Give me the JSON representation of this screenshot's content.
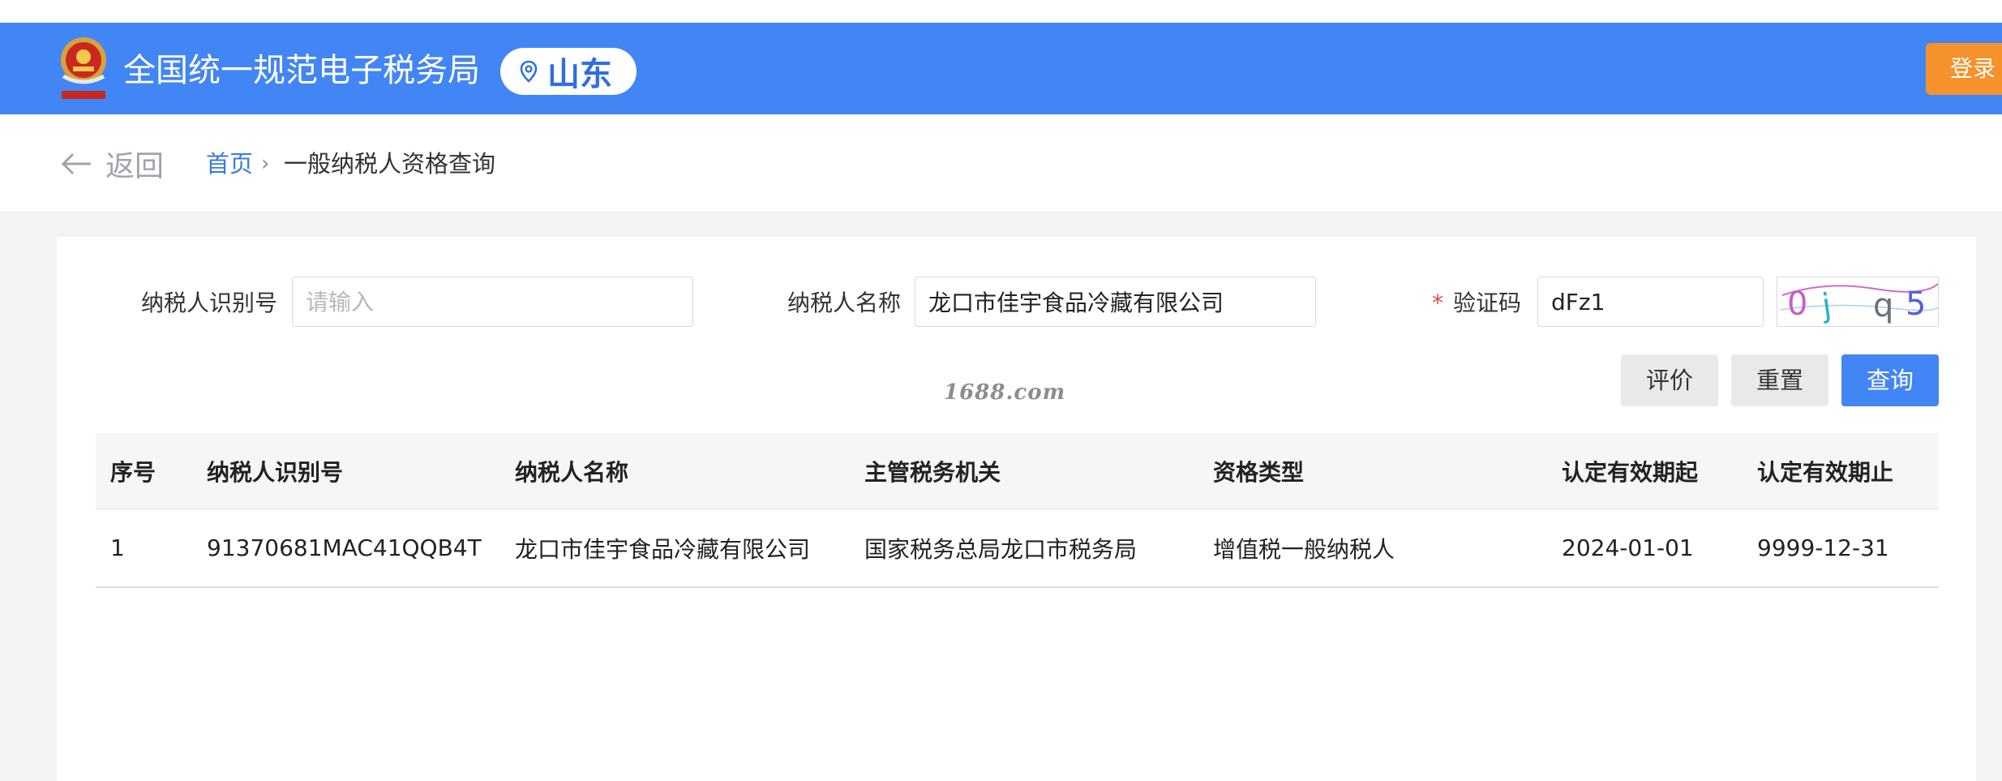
{
  "header": {
    "site_title": "全国统一规范电子税务局",
    "region": "山东",
    "login_label": "登录",
    "brand_color": "#4285f4",
    "login_color": "#f5922b"
  },
  "nav": {
    "back_label": "返回",
    "breadcrumb_home": "首页",
    "breadcrumb_separator": "›",
    "breadcrumb_current": "一般纳税人资格查询"
  },
  "form": {
    "taxpayer_id_label": "纳税人识别号",
    "taxpayer_id_value": "",
    "taxpayer_id_placeholder": "请输入",
    "taxpayer_name_label": "纳税人名称",
    "taxpayer_name_value": "龙口市佳宇食品冷藏有限公司",
    "captcha_required_mark": "*",
    "captcha_label": "验证码",
    "captcha_value": "dFz1",
    "captcha_image_text": "0j q5"
  },
  "buttons": {
    "rate_label": "评价",
    "reset_label": "重置",
    "query_label": "查询"
  },
  "watermark": "1688.com",
  "table": {
    "columns": [
      "序号",
      "纳税人识别号",
      "纳税人名称",
      "主管税务机关",
      "资格类型",
      "认定有效期起",
      "认定有效期止"
    ],
    "rows": [
      [
        "1",
        "91370681MAC41QQB4T",
        "龙口市佳宇食品冷藏有限公司",
        "国家税务总局龙口市税务局",
        "增值税一般纳税人",
        "2024-01-01",
        "9999-12-31"
      ]
    ]
  }
}
